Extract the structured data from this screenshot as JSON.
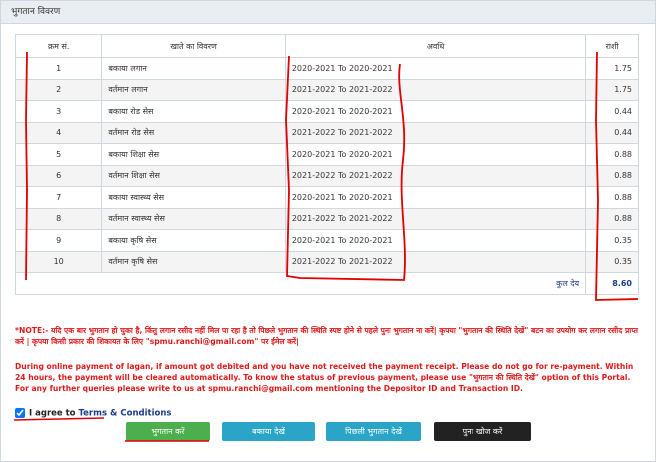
{
  "panel": {
    "title": "भुगतान विवरण"
  },
  "table": {
    "headers": {
      "sr": "क्रम सं.",
      "desc": "खाते का विवरण",
      "period": "अवधि",
      "amount": "राशी"
    },
    "rows": [
      {
        "sr": "1",
        "desc": "बकाया लगान",
        "period": "2020-2021 To 2020-2021",
        "amount": "1.75"
      },
      {
        "sr": "2",
        "desc": "वर्तमान लगान",
        "period": "2021-2022 To 2021-2022",
        "amount": "1.75"
      },
      {
        "sr": "3",
        "desc": "बकाया रोड सेस",
        "period": "2020-2021 To 2020-2021",
        "amount": "0.44"
      },
      {
        "sr": "4",
        "desc": "वर्तमान रोड सेस",
        "period": "2021-2022 To 2021-2022",
        "amount": "0.44"
      },
      {
        "sr": "5",
        "desc": "बकाया शिक्षा सेस",
        "period": "2020-2021 To 2020-2021",
        "amount": "0.88"
      },
      {
        "sr": "6",
        "desc": "वर्तमान शिक्षा सेस",
        "period": "2021-2022 To 2021-2022",
        "amount": "0.88"
      },
      {
        "sr": "7",
        "desc": "बकाया स्वास्थ्य सेस",
        "period": "2020-2021 To 2020-2021",
        "amount": "0.88"
      },
      {
        "sr": "8",
        "desc": "वर्तमान स्वास्थ्य सेस",
        "period": "2021-2022 To 2021-2022",
        "amount": "0.88"
      },
      {
        "sr": "9",
        "desc": "बकाया कृषि सेस",
        "period": "2020-2021 To 2020-2021",
        "amount": "0.35"
      },
      {
        "sr": "10",
        "desc": "वर्तमान कृषि सेस",
        "period": "2021-2022 To 2021-2022",
        "amount": "0.35"
      }
    ],
    "total_label": "कुल देय",
    "total_value": "8.60"
  },
  "notes": {
    "hindi": "*NOTE:- यदि एक बार भुगतान हो चुका है, किंतु लगान रसीद नहीं मिल पा रहा है तो पिछले भुगतान की स्थिति स्पष्ट होने से पहले पुनः भुगतान ना करें| कृपया \"भुगतान की स्थिति देखें\" बटन का उपयोग कर लगान रसीद प्राप्त करें | कृपया किसी प्रकार की शिकायत के लिए \"spmu.ranchi@gmail.com\" पर ईमेल करें|",
    "english": "During online payment of lagan, if amount got debited and you have not received the payment receipt. Please do not go for re-payment. Within 24 hours, the payment will be cleared automatically. To know the status of previous payment, please use \"भुगतान की स्थिति देखें\" option of this Portal. For any further queries please write to us at spmu.ranchi@gmail.com mentioning the Depositor ID and Transaction ID."
  },
  "agree": {
    "prefix": "I agree to ",
    "link": "Terms & Conditions",
    "checked": true
  },
  "buttons": {
    "pay": "भुगतान करें",
    "due": "बकाया देखें",
    "prev": "पिछली भुगतान देखें",
    "search": "पुनः खोज करें"
  },
  "colors": {
    "pay": "#4cae4c",
    "info": "#2aa5c7",
    "dark": "#222222",
    "note": "#e01a1a",
    "annotation": "#e00000"
  }
}
